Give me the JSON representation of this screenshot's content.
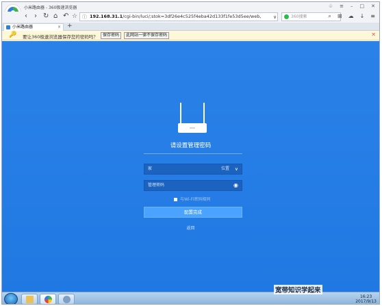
{
  "window": {
    "title": "小米路由器 - 360极速浏览器"
  },
  "nav": {
    "back": "‹",
    "forward": "›",
    "home": "⌂",
    "undo": "↶",
    "star": "☆",
    "url_host": "192.168.31.1",
    "url_rest": "/cgi-bin/luci/;stok=3df26e4c525f4eba42d133f1fe53d5ee/web,",
    "search_placeholder": "360搜索"
  },
  "tabs": [
    {
      "label": "小米路由器"
    }
  ],
  "password_bar": {
    "message": "要让360极速浏览器保存您的密码吗？",
    "save_label": "保存密码",
    "never_label": "此网站一律不保存密码"
  },
  "page": {
    "heading": "请设置管理密码",
    "location_value": "家",
    "location_label": "位置",
    "password_placeholder": "管理密码",
    "checkbox_label": "与Wi-Fi密码相同",
    "submit_label": "配置完成",
    "back_label": "返回"
  },
  "taskbar": {
    "watermark": "宽带知识学起来",
    "time": "16:23",
    "date": "2017/9/13"
  },
  "colors": {
    "page_bg": "#2a82e8",
    "accent": "#4aa3ff",
    "field_bg": "#1b63bf"
  }
}
